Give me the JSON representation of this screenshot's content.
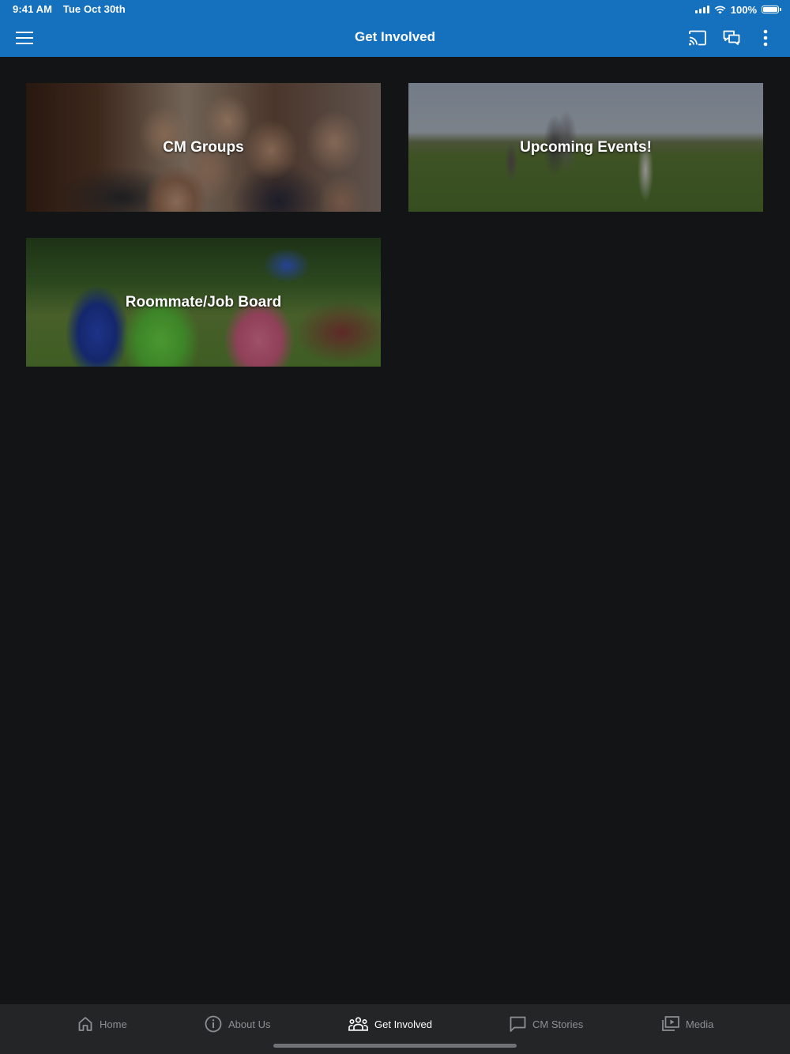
{
  "status_bar": {
    "time": "9:41 AM",
    "date": "Tue Oct 30th",
    "battery": "100%",
    "icons": [
      "signal-icon",
      "wifi-icon",
      "battery-icon"
    ]
  },
  "nav": {
    "title": "Get Involved",
    "left_icon": "hamburger-menu-icon",
    "right_icons": [
      "cast-icon",
      "chat-icon",
      "more-vertical-icon"
    ]
  },
  "cards": [
    {
      "label": "CM Groups"
    },
    {
      "label": "Upcoming Events!"
    },
    {
      "label": "Roommate/Job Board"
    }
  ],
  "tabs": [
    {
      "label": "Home",
      "icon": "home-icon",
      "active": false
    },
    {
      "label": "About Us",
      "icon": "info-icon",
      "active": false
    },
    {
      "label": "Get Involved",
      "icon": "people-group-icon",
      "active": true
    },
    {
      "label": "CM Stories",
      "icon": "chat-bubble-icon",
      "active": false
    },
    {
      "label": "Media",
      "icon": "media-play-icon",
      "active": false
    }
  ],
  "colors": {
    "header": "#1570bd",
    "background": "#131416",
    "tabbar": "#242527",
    "tab_inactive": "#8d8f93",
    "tab_active": "#ffffff"
  }
}
